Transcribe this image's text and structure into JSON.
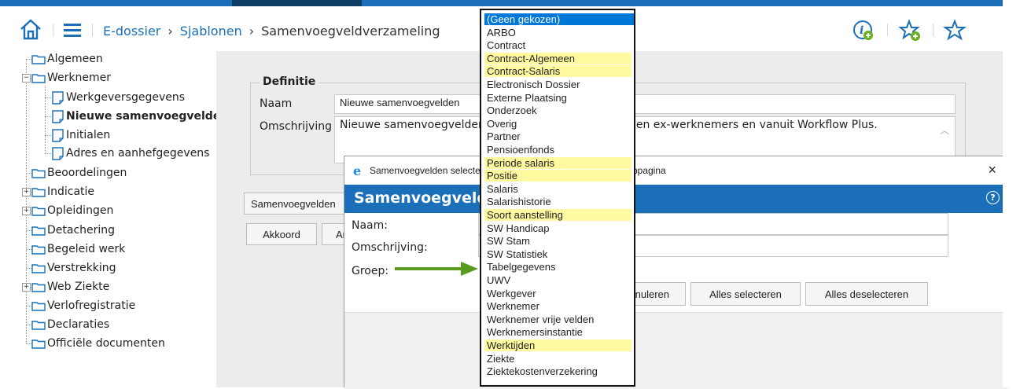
{
  "header": {
    "breadcrumb": [
      "E-dossier",
      "Sjablonen",
      "Samenvoegveldverzameling"
    ],
    "separator": "›"
  },
  "tree": [
    {
      "label": "Algemeen",
      "bold": false
    },
    {
      "label": "Werknemer",
      "bold": false
    },
    {
      "label": "Werkgeversgegevens",
      "bold": false
    },
    {
      "label": "Nieuwe samenvoegvelden",
      "bold": true
    },
    {
      "label": "Initialen",
      "bold": false
    },
    {
      "label": "Adres en aanhefgegevens",
      "bold": false
    },
    {
      "label": "Beoordelingen",
      "bold": false
    },
    {
      "label": "Indicatie",
      "bold": false
    },
    {
      "label": "Opleidingen",
      "bold": false
    },
    {
      "label": "Detachering",
      "bold": false
    },
    {
      "label": "Begeleid werk",
      "bold": false
    },
    {
      "label": "Verstrekking",
      "bold": false
    },
    {
      "label": "Web Ziekte",
      "bold": false
    },
    {
      "label": "Verlofregistratie",
      "bold": false
    },
    {
      "label": "Declaraties",
      "bold": false
    },
    {
      "label": "Officiële documenten",
      "bold": false
    }
  ],
  "form": {
    "legend": "Definitie",
    "naam_label": "Naam",
    "naam_value": "Nieuwe samenvoegvelden",
    "omschrijving_label": "Omschrijving",
    "omschrijving_value": "Nieuwe samenvoegvelden voor huidige, toekomstige en ex-werknemers en vanuit Workflow Plus.",
    "samenvoeg_button": "Samenvoegvelden",
    "akkoord_button": "Akkoord",
    "annuleren_button": "Annuleren"
  },
  "dialog": {
    "window_title": "Samenvoegvelden selecteren -- Webpagina-dialoogvenster webpagina",
    "heading": "Samenvoegvelden",
    "naam_label": "Naam:",
    "omschrijving_label": "Omschrijving:",
    "groep_label": "Groep:",
    "annuleren_button": "Annuleren",
    "select_all_button": "Alles selecteren",
    "deselect_all_button": "Alles deselecteren",
    "close_glyph": "×",
    "help_glyph": "?"
  },
  "dropdown": {
    "selected_index": 0,
    "options": [
      {
        "label": "(Geen gekozen)",
        "highlight": false
      },
      {
        "label": "ARBO",
        "highlight": false
      },
      {
        "label": "Contract",
        "highlight": false
      },
      {
        "label": "Contract-Algemeen",
        "highlight": true
      },
      {
        "label": "Contract-Salaris",
        "highlight": true
      },
      {
        "label": "Electronisch Dossier",
        "highlight": false
      },
      {
        "label": "Externe Plaatsing",
        "highlight": false
      },
      {
        "label": "Onderzoek",
        "highlight": false
      },
      {
        "label": "Overig",
        "highlight": false
      },
      {
        "label": "Partner",
        "highlight": false
      },
      {
        "label": "Pensioenfonds",
        "highlight": false
      },
      {
        "label": "Periode salaris",
        "highlight": true
      },
      {
        "label": "Positie",
        "highlight": true
      },
      {
        "label": "Salaris",
        "highlight": false
      },
      {
        "label": "Salarishistorie",
        "highlight": false
      },
      {
        "label": "Soort aanstelling",
        "highlight": true
      },
      {
        "label": "SW Handicap",
        "highlight": false
      },
      {
        "label": "SW Stam",
        "highlight": false
      },
      {
        "label": "SW Statistiek",
        "highlight": false
      },
      {
        "label": "Tabelgegevens",
        "highlight": false
      },
      {
        "label": "UWV",
        "highlight": false
      },
      {
        "label": "Werkgever",
        "highlight": false
      },
      {
        "label": "Werknemer",
        "highlight": false
      },
      {
        "label": "Werknemer vrije velden",
        "highlight": false
      },
      {
        "label": "Werknemersinstantie",
        "highlight": false
      },
      {
        "label": "Werktijden",
        "highlight": true
      },
      {
        "label": "Ziekte",
        "highlight": false
      },
      {
        "label": "Ziektekostenverzekering",
        "highlight": false
      }
    ]
  },
  "colors": {
    "accent": "#1a6fb8",
    "highlight": "#fffaa0",
    "selected": "#0078d7",
    "arrow": "#5a9a1e",
    "icon_green": "#6ab023"
  }
}
